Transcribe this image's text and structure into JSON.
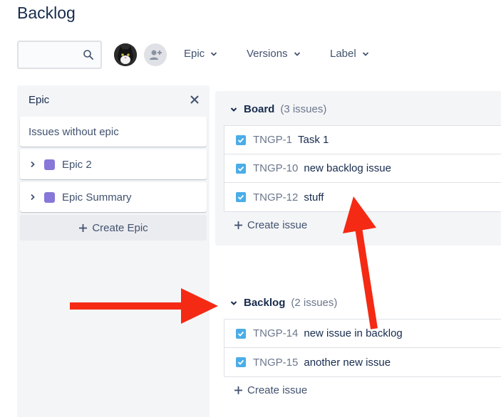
{
  "page": {
    "title": "Backlog"
  },
  "toolbar": {
    "search_placeholder": "",
    "filters": [
      {
        "label": "Epic"
      },
      {
        "label": "Versions"
      },
      {
        "label": "Label"
      }
    ]
  },
  "epic_panel": {
    "title": "Epic",
    "no_epic_label": "Issues without epic",
    "epics": [
      {
        "label": "Epic 2",
        "color": "#8777d9"
      },
      {
        "label": "Epic Summary",
        "color": "#8777d9"
      }
    ],
    "create_label": "Create Epic"
  },
  "board": {
    "name": "Board",
    "count": "(3 issues)",
    "issues": [
      {
        "key": "TNGP-1",
        "summary": "Task 1"
      },
      {
        "key": "TNGP-10",
        "summary": "new backlog issue"
      },
      {
        "key": "TNGP-12",
        "summary": "stuff"
      }
    ],
    "create_label": "Create issue"
  },
  "backlog": {
    "name": "Backlog",
    "count": "(2 issues)",
    "issues": [
      {
        "key": "TNGP-14",
        "summary": "new issue in backlog"
      },
      {
        "key": "TNGP-15",
        "summary": "another new issue"
      }
    ],
    "create_label": "Create issue"
  },
  "colors": {
    "accent": "#4bade8",
    "annotation": "#f42a14",
    "epic": "#8777d9"
  }
}
